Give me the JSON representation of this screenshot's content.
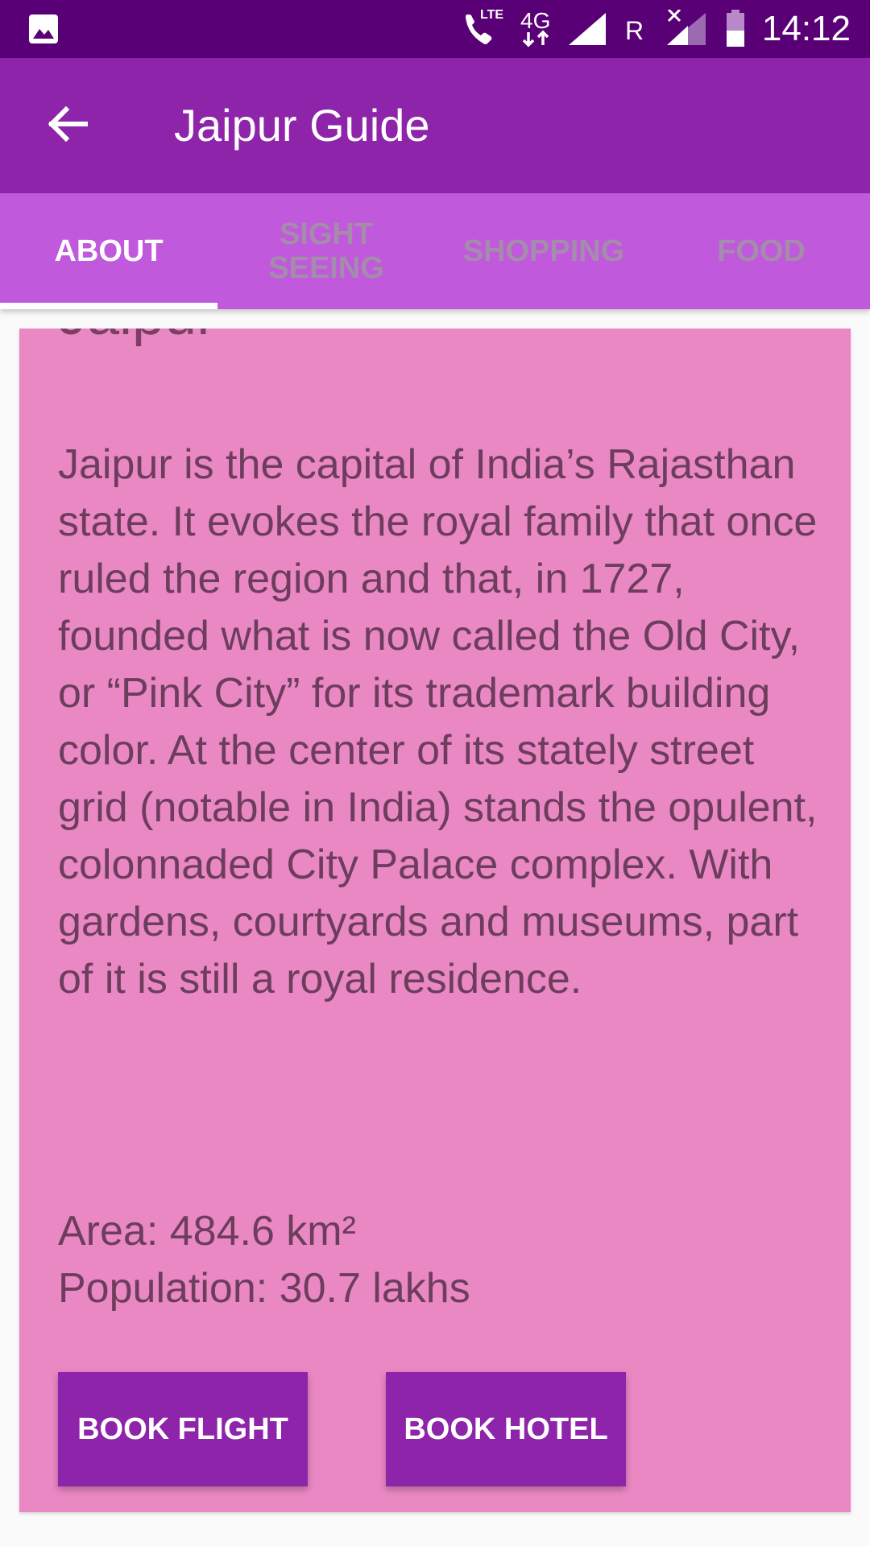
{
  "status_bar": {
    "time": "14:12",
    "network_label": "4G",
    "lte_label": "LTE",
    "roaming_label": "R",
    "icons": [
      "image-icon",
      "volte-call-icon",
      "data-arrows-icon",
      "signal-icon",
      "roaming-icon",
      "no-sim-signal-icon",
      "battery-icon"
    ]
  },
  "app_bar": {
    "title": "Jaipur Guide",
    "back_icon": "arrow-back-icon"
  },
  "tabs": [
    {
      "label": "ABOUT",
      "active": true
    },
    {
      "label": "SIGHT\nSEEING",
      "active": false
    },
    {
      "label": "SHOPPING",
      "active": false
    },
    {
      "label": "FOOD",
      "active": false
    }
  ],
  "about": {
    "heading": "Jaipur",
    "description": "Jaipur is the capital of India’s Rajasthan state. It evokes the royal family that once ruled the region and that, in 1727, founded what is now called the Old City, or “Pink City” for its trademark building color. At the center of its stately street grid (notable in India) stands the opulent, colonnaded City Palace complex. With gardens, courtyards and museums, part of it is still a royal residence.",
    "area": "Area: 484.6 km²",
    "population": "Population: 30.7 lakhs",
    "book_flight_label": "BOOK FLIGHT",
    "book_hotel_label": "BOOK HOTEL"
  },
  "colors": {
    "status_bar": "#5a0077",
    "app_bar": "#8e24aa",
    "tab_bar": "#c059dc",
    "card": "#ea88c4",
    "text": "#6d3d5d",
    "button": "#8e24aa"
  }
}
